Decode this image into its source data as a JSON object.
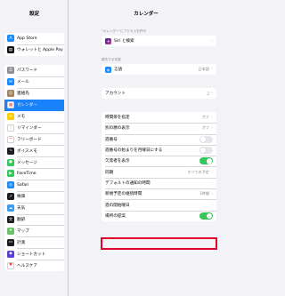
{
  "status": {
    "time": "20:51",
    "battery": "90%"
  },
  "sidebar": {
    "title": "設定",
    "group1": [
      {
        "label": "App Store",
        "icon": "app-store-icon",
        "color": "#1a8cff",
        "glyph": "A"
      },
      {
        "label": "ウォレットと Apple Pay",
        "icon": "wallet-icon",
        "color": "#111111",
        "glyph": "▤"
      }
    ],
    "group2": [
      {
        "label": "パスワード",
        "icon": "key-icon",
        "color": "#8e8e93",
        "glyph": "⚿"
      },
      {
        "label": "メール",
        "icon": "mail-icon",
        "color": "#1a8cff",
        "glyph": "✉"
      },
      {
        "label": "連絡先",
        "icon": "contacts-icon",
        "color": "#a2845e",
        "glyph": "☺"
      },
      {
        "label": "カレンダー",
        "icon": "calendar-icon",
        "color": "#ffffff",
        "glyph": "▦",
        "selected": true
      },
      {
        "label": "メモ",
        "icon": "notes-icon",
        "color": "#ffcc00",
        "glyph": "≡"
      },
      {
        "label": "リマインダー",
        "icon": "reminders-icon",
        "color": "#ffffff",
        "glyph": "⋮"
      },
      {
        "label": "フリーボード",
        "icon": "freeform-icon",
        "color": "#ffffff",
        "glyph": "~"
      },
      {
        "label": "ボイスメモ",
        "icon": "voice-memos-icon",
        "color": "#1c1c1e",
        "glyph": "∿"
      },
      {
        "label": "メッセージ",
        "icon": "messages-icon",
        "color": "#34c759",
        "glyph": "●"
      },
      {
        "label": "FaceTime",
        "icon": "facetime-icon",
        "color": "#34c759",
        "glyph": "▶"
      },
      {
        "label": "Safari",
        "icon": "safari-icon",
        "color": "#1a8cff",
        "glyph": "◎"
      },
      {
        "label": "株価",
        "icon": "stocks-icon",
        "color": "#1c1c1e",
        "glyph": "↗"
      },
      {
        "label": "天気",
        "icon": "weather-icon",
        "color": "#3a9bf5",
        "glyph": "☁"
      },
      {
        "label": "翻訳",
        "icon": "translate-icon",
        "color": "#1c1c1e",
        "glyph": "文"
      },
      {
        "label": "マップ",
        "icon": "maps-icon",
        "color": "#6cc26c",
        "glyph": "➤"
      },
      {
        "label": "計測",
        "icon": "measure-icon",
        "color": "#1c1c1e",
        "glyph": "▭"
      },
      {
        "label": "ショートカット",
        "icon": "shortcuts-icon",
        "color": "#5b3fd6",
        "glyph": "◆"
      },
      {
        "label": "ヘルスケア",
        "icon": "health-icon",
        "color": "#ffffff",
        "glyph": "♥"
      }
    ]
  },
  "detail": {
    "title": "カレンダー",
    "siri_header": "\"カレンダー\"にアクセスを許可",
    "siri_label": "Siri と検索",
    "language_header": "優先する言語",
    "language_label": "言語",
    "language_value": "日本語",
    "accounts_label": "アカウント",
    "accounts_value": "2",
    "rows": [
      {
        "label": "時間帯を指定",
        "value": "オフ",
        "type": "value"
      },
      {
        "label": "別の暦の表示",
        "value": "オフ",
        "type": "value"
      },
      {
        "label": "週番号",
        "type": "toggle",
        "on": false
      },
      {
        "label": "週番号の始まりを月曜日にする",
        "type": "toggle",
        "on": false
      },
      {
        "label": "欠席者を表示",
        "type": "toggle",
        "on": true
      },
      {
        "label": "同期",
        "value": "すべての予定",
        "type": "value"
      },
      {
        "label": "デフォルトの通知の時間",
        "value": "",
        "type": "value"
      },
      {
        "label": "新規予定の継続時間",
        "value": "1時間",
        "type": "value"
      },
      {
        "label": "週の開始曜日",
        "value": "",
        "type": "value"
      },
      {
        "label": "場所の提案",
        "type": "toggle",
        "on": true
      }
    ]
  }
}
